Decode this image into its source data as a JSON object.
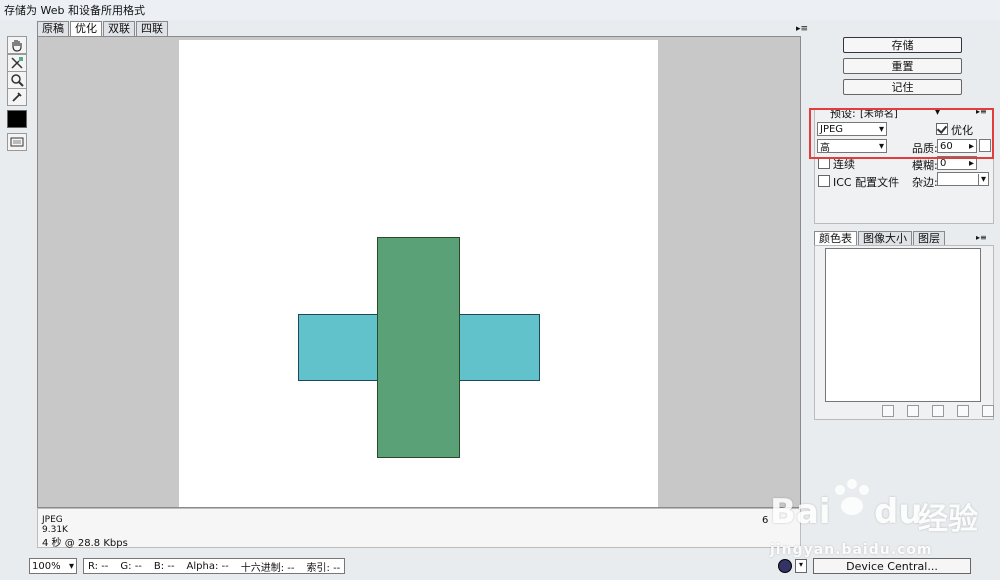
{
  "window": {
    "title": "存储为 Web 和设备所用格式"
  },
  "tabs": [
    {
      "label": "原稿"
    },
    {
      "label": "优化"
    },
    {
      "label": "双联"
    },
    {
      "label": "四联"
    }
  ],
  "info": {
    "format": "JPEG",
    "size": "9.31K",
    "time": "4 秒 @ 28.8 Kbps",
    "right": "6"
  },
  "status": {
    "zoom": "100%",
    "r": "R:  --",
    "g": "G:  --",
    "b": "B:  --",
    "alpha": "Alpha:  --",
    "hex": "十六进制:  --",
    "index": "索引:  --"
  },
  "buttons": {
    "save": "存储",
    "reset": "重置",
    "remember": "记住",
    "device": "Device Central..."
  },
  "settings": {
    "preset_label": "预设:",
    "preset_value": "[未命名]",
    "format": "JPEG",
    "optimize_label": "优化",
    "quality_level": "高",
    "quality_label": "品质:",
    "quality_value": "60",
    "progressive_label": "连续",
    "blur_label": "模糊:",
    "blur_value": "0",
    "icc_label": "ICC 配置文件",
    "matte_label": "杂边:"
  },
  "color_tabs": [
    {
      "label": "颜色表"
    },
    {
      "label": "图像大小"
    },
    {
      "label": "图层"
    }
  ],
  "watermark": {
    "brand": "Bai",
    "brand2": "du",
    "cn": "经验",
    "url": "jingyan.baidu.com"
  },
  "colors": {
    "cyan": "#62c2cb",
    "green": "#5aa178",
    "highlight": "#e23d3d"
  }
}
